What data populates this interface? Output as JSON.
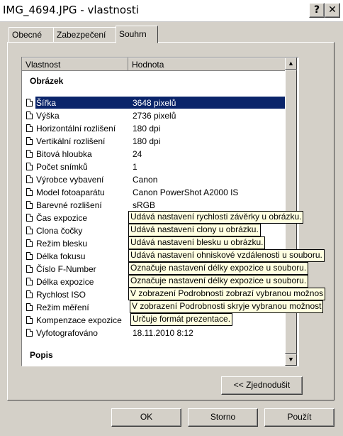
{
  "window": {
    "title": "IMG_4694.JPG - vlastnosti",
    "help_label": "?",
    "close_label": "✕"
  },
  "tabs": [
    {
      "label": "Obecné"
    },
    {
      "label": "Zabezpečení"
    },
    {
      "label": "Souhrn"
    }
  ],
  "active_tab": "Souhrn",
  "columns": {
    "property": "Vlastnost",
    "value": "Hodnota"
  },
  "groups": {
    "image": "Obrázek",
    "description": "Popis"
  },
  "rows": [
    {
      "name": "Šířka",
      "value": "3648 pixelů"
    },
    {
      "name": "Výška",
      "value": "2736 pixelů"
    },
    {
      "name": "Horizontální rozlišení",
      "value": "180 dpi"
    },
    {
      "name": "Vertikální rozlišení",
      "value": "180 dpi"
    },
    {
      "name": "Bitová hloubka",
      "value": "24"
    },
    {
      "name": "Počet snímků",
      "value": "1"
    },
    {
      "name": "Výrobce vybavení",
      "value": "Canon"
    },
    {
      "name": "Model fotoaparátu",
      "value": "Canon PowerShot A2000 IS"
    },
    {
      "name": "Barevné rozlišení",
      "value": "sRGB"
    },
    {
      "name": "Čas expozice",
      "value": ""
    },
    {
      "name": "Clona čočky",
      "value": ""
    },
    {
      "name": "Režim blesku",
      "value": ""
    },
    {
      "name": "Délka fokusu",
      "value": ""
    },
    {
      "name": "Číslo F-Number",
      "value": ""
    },
    {
      "name": "Délka expozice",
      "value": ""
    },
    {
      "name": "Rychlost ISO",
      "value": ""
    },
    {
      "name": "Režim měření",
      "value": ""
    },
    {
      "name": "Kompenzace expozice",
      "value": ""
    },
    {
      "name": "Vyfotografováno",
      "value": "18.11.2010 8:12"
    }
  ],
  "tooltips": [
    "Udává nastavení rychlosti závěrky u obrázku.",
    "Udává nastavení clony u obrázku.",
    "Udává nastavení blesku u obrázku.",
    "Udává nastavení ohniskové vzdálenosti u souboru.",
    "Označuje nastavení délky expozice u souboru.",
    "Označuje nastavení délky expozice u souboru.",
    "V zobrazení Podrobnosti zobrazí vybranou možnos",
    "V zobrazení Podrobnosti skryje vybranou možnost",
    "Určuje formát prezentace."
  ],
  "buttons": {
    "simplify": "<< Zjednodušit",
    "ok": "OK",
    "cancel": "Storno",
    "apply": "Použít"
  },
  "colors": {
    "selection": "#0a246a",
    "tooltip_bg": "#ffffe1",
    "dialog_bg": "#d4d0c8"
  }
}
